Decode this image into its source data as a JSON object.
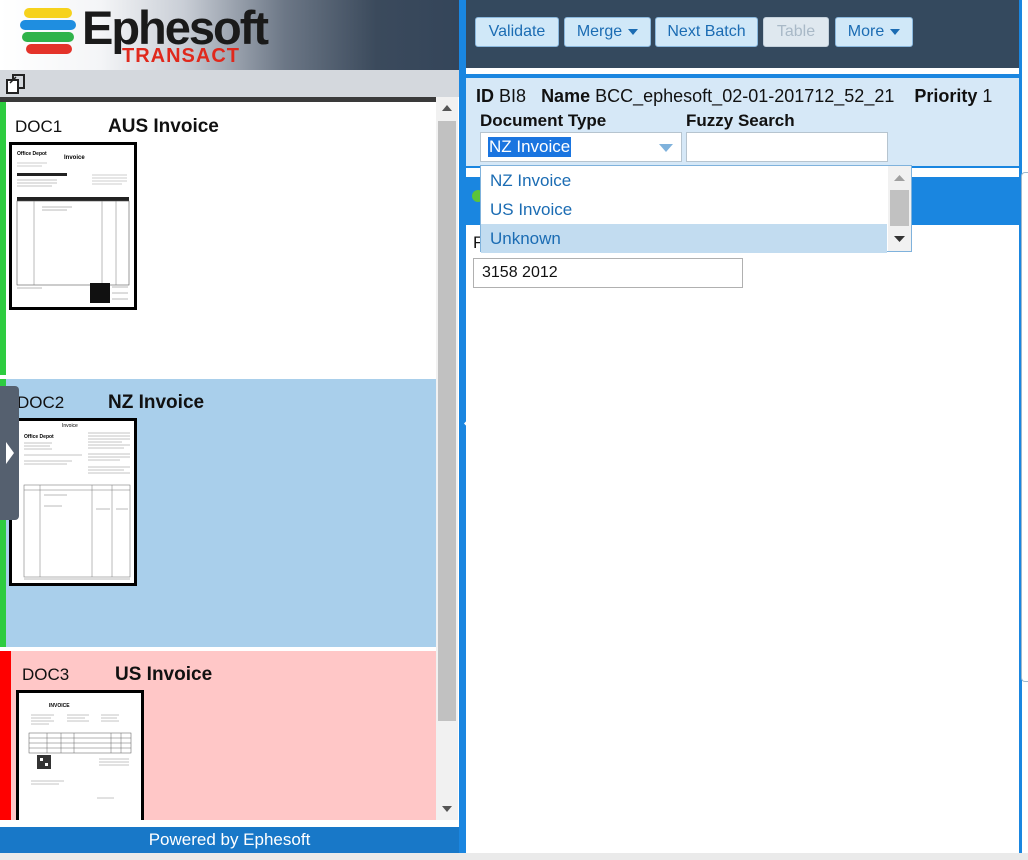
{
  "brand": {
    "name": "Ephesoft",
    "product": "TRANSACT",
    "stripe_colors": [
      "#f6d21c",
      "#1f8ee0",
      "#2fb34a",
      "#e4332a"
    ]
  },
  "documents": [
    {
      "id": "DOC1",
      "type": "AUS Invoice",
      "status_color": "#2ecc40",
      "background": "#ffffff"
    },
    {
      "id": "DOC2",
      "type": "NZ Invoice",
      "status_color": "#2ecc40",
      "background": "#a9cfeb"
    },
    {
      "id": "DOC3",
      "type": "US Invoice",
      "status_color": "#ff0000",
      "background": "#ffc7c7"
    }
  ],
  "thumbnail_text": {
    "office_depot": "Office Depot",
    "invoice": "Invoice",
    "invoice_caps": "INVOICE"
  },
  "footer": {
    "powered_by": "Powered by Ephesoft"
  },
  "toolbar": {
    "validate": "Validate",
    "merge": "Merge",
    "next_batch": "Next Batch",
    "table": "Table",
    "more": "More"
  },
  "batch": {
    "id_label": "ID",
    "id": "BI8",
    "name_label": "Name",
    "name": "BCC_ephesoft_02-01-201712_52_21",
    "priority_label": "Priority",
    "priority": "1"
  },
  "form": {
    "document_type_label": "Document Type",
    "document_type_value": "NZ Invoice",
    "fuzzy_search_label": "Fuzzy Search",
    "fuzzy_search_value": "",
    "field_label_fragment": "F",
    "field_value": "3158 2012"
  },
  "dropdown": {
    "options": [
      "NZ Invoice",
      "US Invoice",
      "Unknown"
    ],
    "highlighted": "Unknown"
  },
  "colors": {
    "accent": "#1a86e0",
    "toolbar_bg": "#34495e",
    "button_bg": "#d0e8f8",
    "button_text": "#1b6cb3"
  }
}
